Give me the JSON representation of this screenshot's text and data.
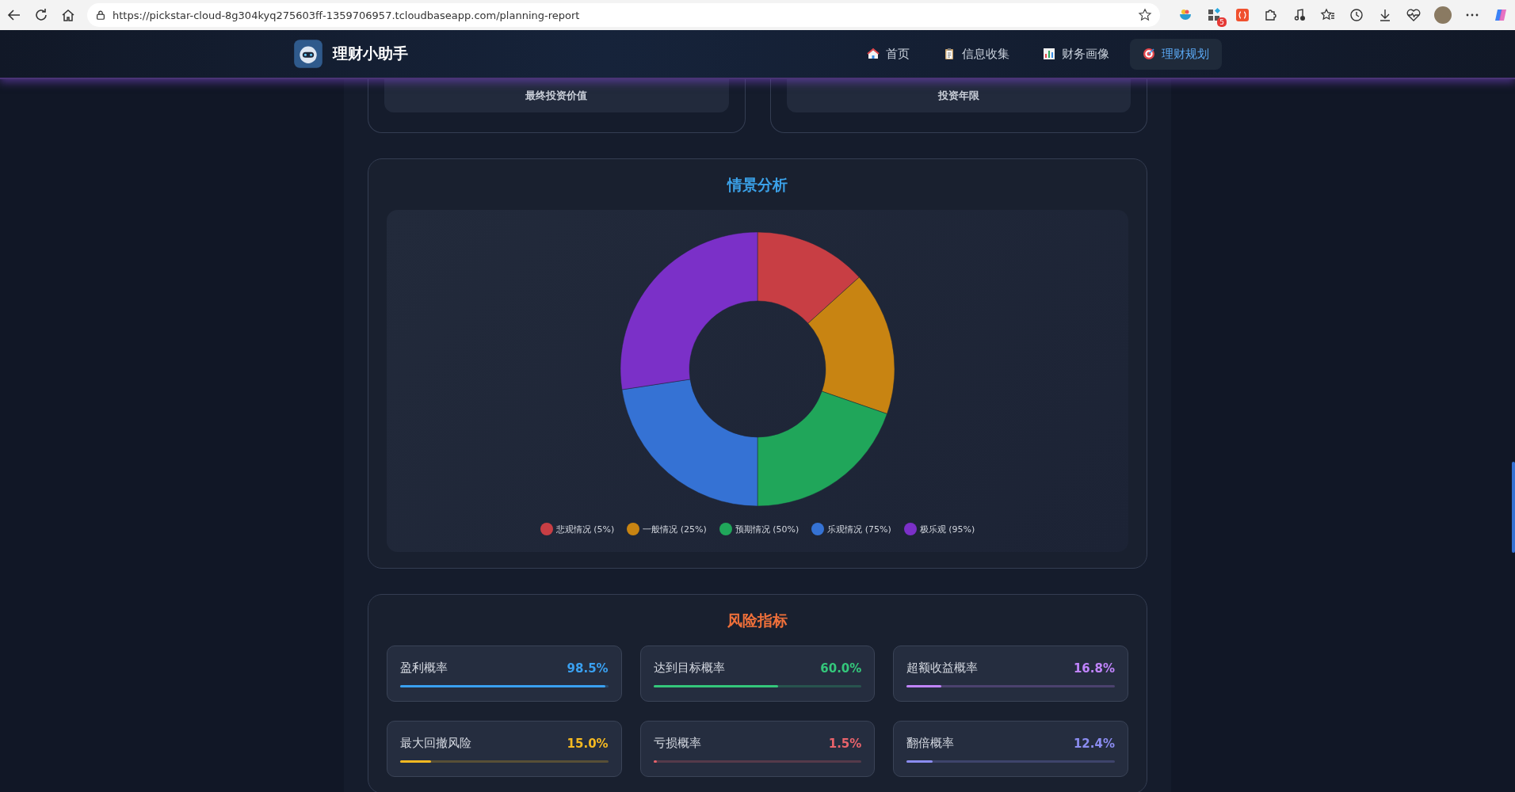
{
  "browser": {
    "url": "https://pickstar-cloud-8g304kyq275603ff-1359706957.tcloudbaseapp.com/planning-report",
    "extension_badge": "5"
  },
  "header": {
    "app_name": "理财小助手",
    "nav": [
      {
        "label": "首页",
        "kind": "home",
        "selected": false
      },
      {
        "label": "信息收集",
        "kind": "clipboard",
        "selected": false
      },
      {
        "label": "财务画像",
        "kind": "chart",
        "selected": false
      },
      {
        "label": "理财规划",
        "kind": "target",
        "selected": true
      }
    ]
  },
  "summary_cards": [
    {
      "label": "最终投资价值"
    },
    {
      "label": "投资年限"
    }
  ],
  "scenario": {
    "title": "情景分析",
    "legend": [
      {
        "label": "悲观情况 (5%)",
        "color": "#c83e44"
      },
      {
        "label": "一般情况 (25%)",
        "color": "#c88412"
      },
      {
        "label": "预期情况 (50%)",
        "color": "#20a65a"
      },
      {
        "label": "乐观情况 (75%)",
        "color": "#3572d4"
      },
      {
        "label": "极乐观 (95%)",
        "color": "#7b30c8"
      }
    ]
  },
  "risk": {
    "title": "风险指标",
    "metrics": [
      {
        "label": "盈利概率",
        "value": "98.5%",
        "level": 0.985,
        "color": "#3aa0f0"
      },
      {
        "label": "达到目标概率",
        "value": "60.0%",
        "level": 0.6,
        "color": "#34c77b"
      },
      {
        "label": "超额收益概率",
        "value": "16.8%",
        "level": 0.168,
        "color": "#c084fc"
      },
      {
        "label": "最大回撤风险",
        "value": "15.0%",
        "level": 0.15,
        "color": "#f5b921"
      },
      {
        "label": "亏损概率",
        "value": "1.5%",
        "level": 0.015,
        "color": "#e8636b"
      },
      {
        "label": "翻倍概率",
        "value": "12.4%",
        "level": 0.124,
        "color": "#8b8cf0"
      }
    ]
  }
}
